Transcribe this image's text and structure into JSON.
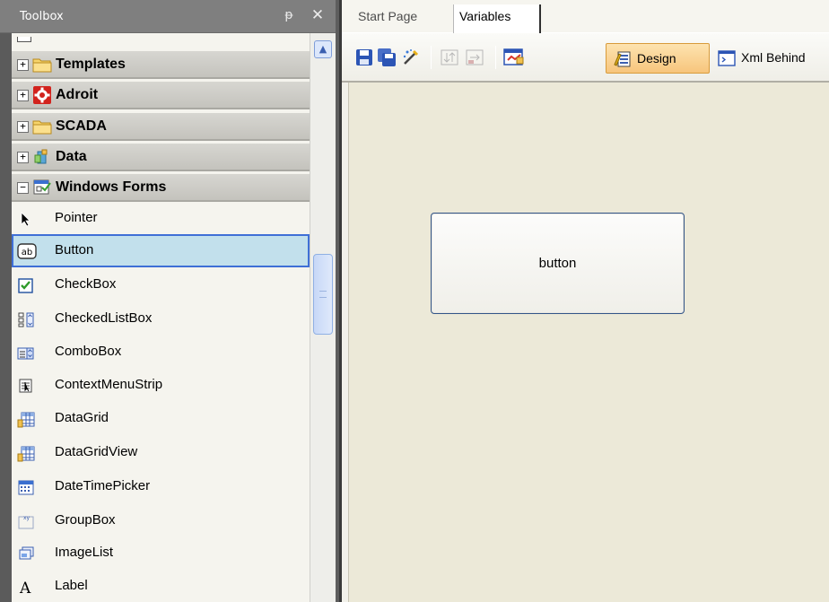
{
  "toolbox": {
    "title": "Toolbox",
    "pin": "ᵽ",
    "close": "✕",
    "categories": [
      {
        "label": "Templates",
        "expander": "+"
      },
      {
        "label": "Adroit",
        "expander": "+"
      },
      {
        "label": "SCADA",
        "expander": "+"
      },
      {
        "label": "Data",
        "expander": "+"
      },
      {
        "label": "Windows Forms",
        "expander": "−"
      }
    ],
    "items": [
      {
        "label": "Pointer",
        "icon": "pointer-icon"
      },
      {
        "label": "Button",
        "icon": "button-ab-icon",
        "selected": true
      },
      {
        "label": "CheckBox",
        "icon": "checkbox-icon"
      },
      {
        "label": "CheckedListBox",
        "icon": "checked-list-box-icon"
      },
      {
        "label": "ComboBox",
        "icon": "combobox-icon"
      },
      {
        "label": "ContextMenuStrip",
        "icon": "context-menu-icon"
      },
      {
        "label": "DataGrid",
        "icon": "datagrid-icon"
      },
      {
        "label": "DataGridView",
        "icon": "datagridview-icon"
      },
      {
        "label": "DateTimePicker",
        "icon": "datetimepicker-icon"
      },
      {
        "label": "GroupBox",
        "icon": "groupbox-icon"
      },
      {
        "label": "ImageList",
        "icon": "imagelist-icon"
      },
      {
        "label": "Label",
        "icon": "label-icon"
      }
    ]
  },
  "document": {
    "tabs": [
      {
        "label": "Start Page",
        "active": false
      },
      {
        "label": "Variables",
        "active": true
      }
    ],
    "toolbar": {
      "design_label": "Design",
      "xml_label": "Xml Behind"
    },
    "form_button_text": "button"
  },
  "colors": {
    "selection_fill": "#c2e0ec",
    "selection_border": "#3f6fd6",
    "design_active": "#f7c57c",
    "canvas": "#ece9d8"
  }
}
